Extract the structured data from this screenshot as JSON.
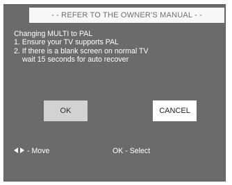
{
  "dialog": {
    "title": "- - REFER TO THE OWNER'S MANUAL - -",
    "message_lines": [
      "Changing MULTI to PAL",
      "1. Ensure your TV supports PAL",
      "2. If there is a blank screen on normal TV",
      "wait 15 seconds for auto recover"
    ],
    "buttons": {
      "ok_label": "OK",
      "cancel_label": "CANCEL"
    },
    "footer": {
      "move_hint": "- Move",
      "select_hint": "OK - Select"
    }
  },
  "icons": {
    "move_left": "left-arrow-icon",
    "move_right": "right-arrow-icon"
  },
  "colors": {
    "dialog_background": "#6b6b6b",
    "title_background": "#f7f7f7",
    "title_text": "#6e6e6e",
    "ok_button_background": "#d2d2d2",
    "cancel_button_background": "#ffffff",
    "text": "#ffffff"
  }
}
